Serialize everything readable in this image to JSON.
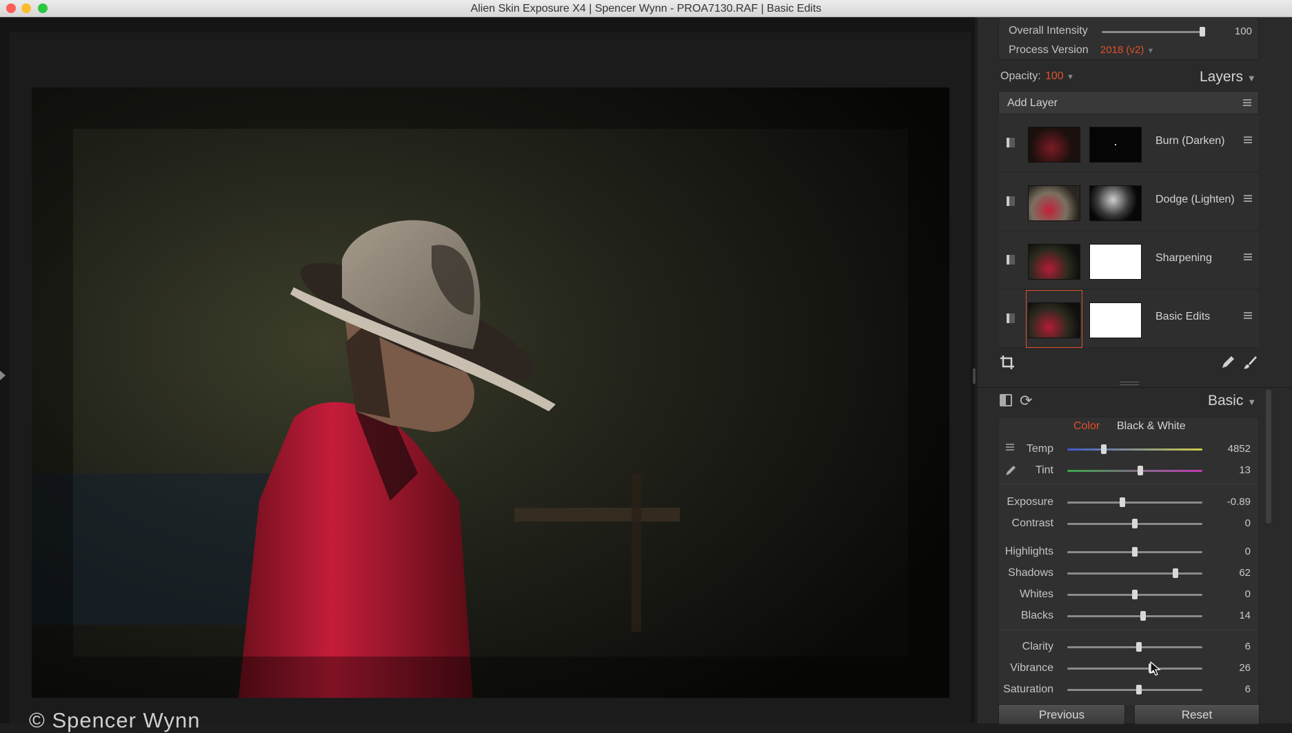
{
  "window": {
    "title": "Alien Skin Exposure X4 | Spencer Wynn - PROA7130.RAF | Basic Edits"
  },
  "viewer": {
    "copyright": "© Spencer Wynn"
  },
  "top_controls": {
    "overall_intensity_label": "Overall Intensity",
    "overall_intensity_value": "100",
    "overall_intensity_level": 1.0,
    "process_version_label": "Process Version",
    "process_version_value": "2018 (v2)"
  },
  "layers": {
    "opacity_label": "Opacity:",
    "opacity_value": "100",
    "panel_title": "Layers",
    "add_layer": "Add Layer",
    "items": [
      {
        "name": "Burn (Darken)",
        "selected": false
      },
      {
        "name": "Dodge (Lighten)",
        "selected": false
      },
      {
        "name": "Sharpening",
        "selected": false
      },
      {
        "name": "Basic Edits",
        "selected": true
      }
    ]
  },
  "basic": {
    "panel_title": "Basic",
    "tab_color": "Color",
    "tab_bw": "Black & White",
    "sliders": [
      {
        "label": "Temp",
        "value": "4852",
        "level": 0.27
      },
      {
        "label": "Tint",
        "value": "13",
        "level": 0.54
      },
      {
        "label": "Exposure",
        "value": "-0.89",
        "level": 0.41
      },
      {
        "label": "Contrast",
        "value": "0",
        "level": 0.5
      },
      {
        "label": "Highlights",
        "value": "0",
        "level": 0.5
      },
      {
        "label": "Shadows",
        "value": "62",
        "level": 0.8
      },
      {
        "label": "Whites",
        "value": "0",
        "level": 0.5
      },
      {
        "label": "Blacks",
        "value": "14",
        "level": 0.56
      },
      {
        "label": "Clarity",
        "value": "6",
        "level": 0.53
      },
      {
        "label": "Vibrance",
        "value": "26",
        "level": 0.62
      },
      {
        "label": "Saturation",
        "value": "6",
        "level": 0.53
      }
    ]
  },
  "footer": {
    "previous": "Previous",
    "reset": "Reset"
  },
  "colors": {
    "accent": "#e0512c",
    "panel_bg": "#2a2a2a",
    "viewer_bg": "#151515"
  }
}
